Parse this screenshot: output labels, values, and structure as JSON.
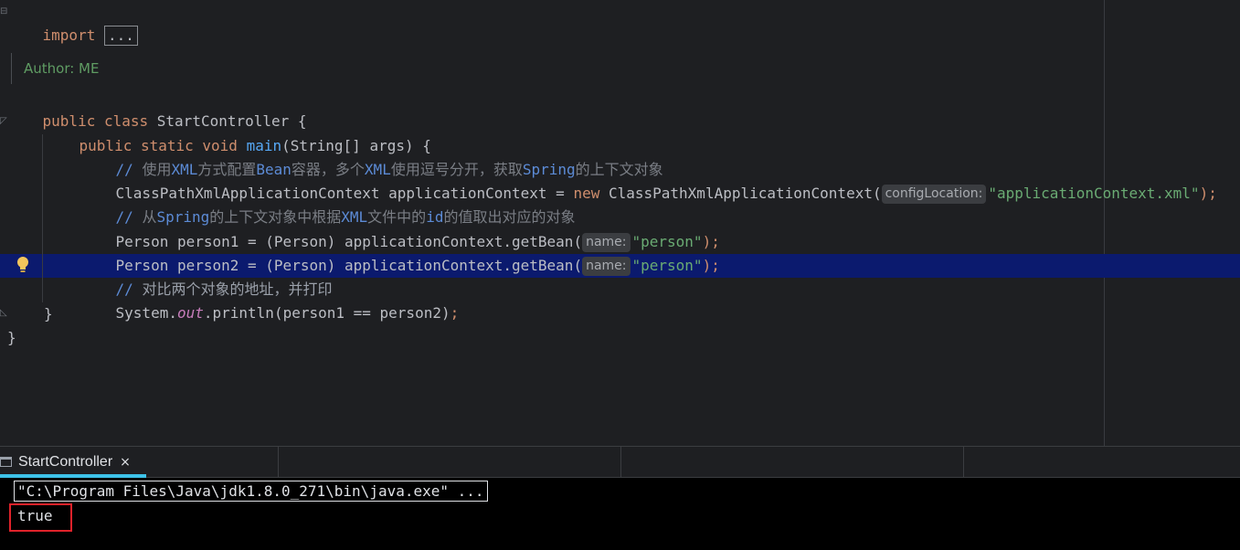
{
  "editor": {
    "import_line": {
      "keyword": "import",
      "folded": "..."
    },
    "doc_author": "Author: ME",
    "class_decl": {
      "kw1": "public",
      "kw2": "class",
      "name": "StartController",
      "brace": "{"
    },
    "main_decl": {
      "kw1": "public",
      "kw2": "static",
      "kw3": "void",
      "name": "main",
      "params": "(String[] args) {"
    },
    "comment1": {
      "prefix": "// ",
      "text_parts": [
        "使用",
        "XML",
        "方式配置",
        "Bean",
        "容器，多个",
        "XML",
        "使用逗号分开，获取",
        "Spring",
        "的上下文对象"
      ]
    },
    "line_ctx": {
      "type": "ClassPathXmlApplicationContext applicationContext = ",
      "kw": "new",
      "ctor": " ClassPathXmlApplicationContext(",
      "hint": "configLocation:",
      "arg": "\"applicationContext.xml\"",
      "end": ");"
    },
    "comment2": {
      "prefix": "// ",
      "text_parts": [
        "从",
        "Spring",
        "的上下文对象中根据",
        "XML",
        "文件中的",
        "id",
        "的值取出对应的对象"
      ]
    },
    "line_p1": {
      "code": "Person person1 = (Person) applicationContext.getBean(",
      "hint": "name:",
      "arg": "\"person\"",
      "end": ");"
    },
    "line_p2": {
      "code": "Person person2 = (Person) applicationContext.getBean(",
      "hint": "name:",
      "arg": "\"person\"",
      "end": ");"
    },
    "comment3": {
      "prefix": "// ",
      "text": "对比两个对象的地址，并打印"
    },
    "line_print": {
      "a": "System.",
      "b": "out",
      "c": ".println(person1 == person2)",
      "d": ";"
    },
    "close_main": "}",
    "close_class": "}"
  },
  "run_panel": {
    "tab_label": "StartController",
    "close_glyph": "×",
    "command": "\"C:\\Program Files\\Java\\jdk1.8.0_271\\bin\\java.exe\" ...",
    "output": "true"
  },
  "colors": {
    "background": "#1e1f22",
    "keyword": "#cf8e6d",
    "string": "#6aab73",
    "function": "#56a8f5",
    "current_line": "#0b1a6e",
    "tab_accent": "#3dc2e9",
    "output_box": "#e0222a"
  }
}
